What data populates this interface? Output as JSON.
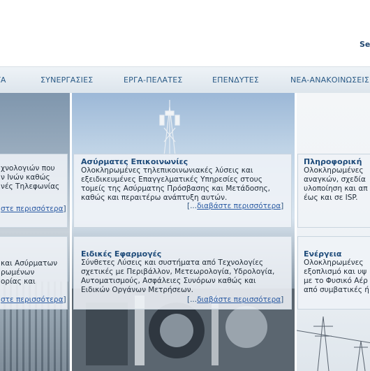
{
  "header": {
    "search_link": "Se"
  },
  "nav": {
    "items": [
      "ΤΑ",
      "ΣΥΝΕΡΓΑΣΙΕΣ",
      "ΕΡΓΑ-ΠΕΛΑΤΕΣ",
      "ΕΠΕΝΔΥΤΕΣ",
      "ΝΕΑ-ΑΝΑΚΟΙΝΩΣΕΙΣ"
    ]
  },
  "cards": {
    "top_left": {
      "lines": [
        "χνολογιών που",
        "ν Ινών καθώς",
        "νές Τηλεφωνίας"
      ],
      "more_link": "στε περισσότερα",
      "more_close": "]"
    },
    "top_mid": {
      "title": "Ασύρματες Επικοινωνίες",
      "lines": [
        "Ολοκληρωμένες τηλεπικοινωνιακές λύσεις και",
        "εξειδικευμένες Επαγγελματικές Υπηρεσίες στους",
        "τομείς της Ασύρματης Πρόσβασης και Μετάδοσης,",
        "καθώς και περαιτέρω ανάπτυξη αυτών."
      ],
      "more_open": "[...",
      "more_link": "διαβάστε περισσότερα",
      "more_close": "]"
    },
    "top_right": {
      "title": "Πληροφορική",
      "lines": [
        "Ολοκληρωμένες",
        "αναγκών, σχεδία",
        "υλοποίηση και απ",
        "έως και σε ISP."
      ]
    },
    "bottom_left": {
      "lines": [
        "και Ασύρματων",
        "ρωμένων",
        "ορίας και"
      ],
      "more_link": "στε περισσότερα",
      "more_close": "]"
    },
    "bottom_mid": {
      "title": "Ειδικές Εφαρμογές",
      "lines": [
        "Σύνθετες Λύσεις και συστήματα από Τεχνολογίες",
        "σχετικές με Περιβάλλον, Μετεωρολογία, Υδρολογία,",
        "Αυτοματισμούς, Ασφάλειες Συνόρων καθώς και",
        "Ειδικών Οργάνων Μετρήσεων."
      ],
      "more_open": "[...",
      "more_link": "διαβάστε περισσότερα",
      "more_close": "]"
    },
    "bottom_right": {
      "title": "Ενέργεια",
      "lines": [
        "Ολοκληρωμένες",
        "εξοπλισμό και υψ",
        "με το Φυσικό Αέρ",
        "από συμβατικές ή"
      ]
    }
  }
}
